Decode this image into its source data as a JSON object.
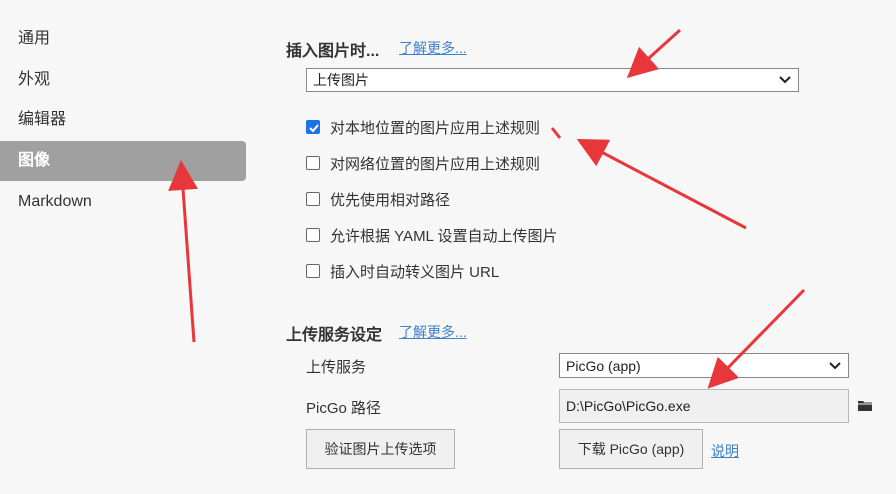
{
  "sidebar": {
    "items": [
      {
        "label": "通用"
      },
      {
        "label": "外观"
      },
      {
        "label": "编辑器"
      },
      {
        "label": "图像"
      },
      {
        "label": "Markdown"
      }
    ]
  },
  "insert_section": {
    "title": "插入图片时...",
    "learn_more": "了解更多...",
    "action_select": "上传图片",
    "options": [
      {
        "label": "对本地位置的图片应用上述规则",
        "checked": true
      },
      {
        "label": "对网络位置的图片应用上述规则",
        "checked": false
      },
      {
        "label": "优先使用相对路径",
        "checked": false
      },
      {
        "label": "允许根据 YAML 设置自动上传图片",
        "checked": false
      },
      {
        "label": "插入时自动转义图片 URL",
        "checked": false
      }
    ]
  },
  "upload_section": {
    "title": "上传服务设定",
    "learn_more": "了解更多...",
    "service_label": "上传服务",
    "service_value": "PicGo (app)",
    "path_label": "PicGo 路径",
    "path_value": "D:\\PicGo\\PicGo.exe",
    "verify_button": "验证图片上传选项",
    "download_button": "下载 PicGo (app)",
    "explain_link": "说明"
  },
  "colors": {
    "accent": "#1a73e8",
    "link": "#3f7fcb",
    "active_sidebar": "#a0a0a0",
    "annotation_arrow": "#e8373a"
  },
  "icons": {
    "folder": "folder-icon",
    "chevron": "chevron-down-icon",
    "check": "checkmark-icon"
  }
}
